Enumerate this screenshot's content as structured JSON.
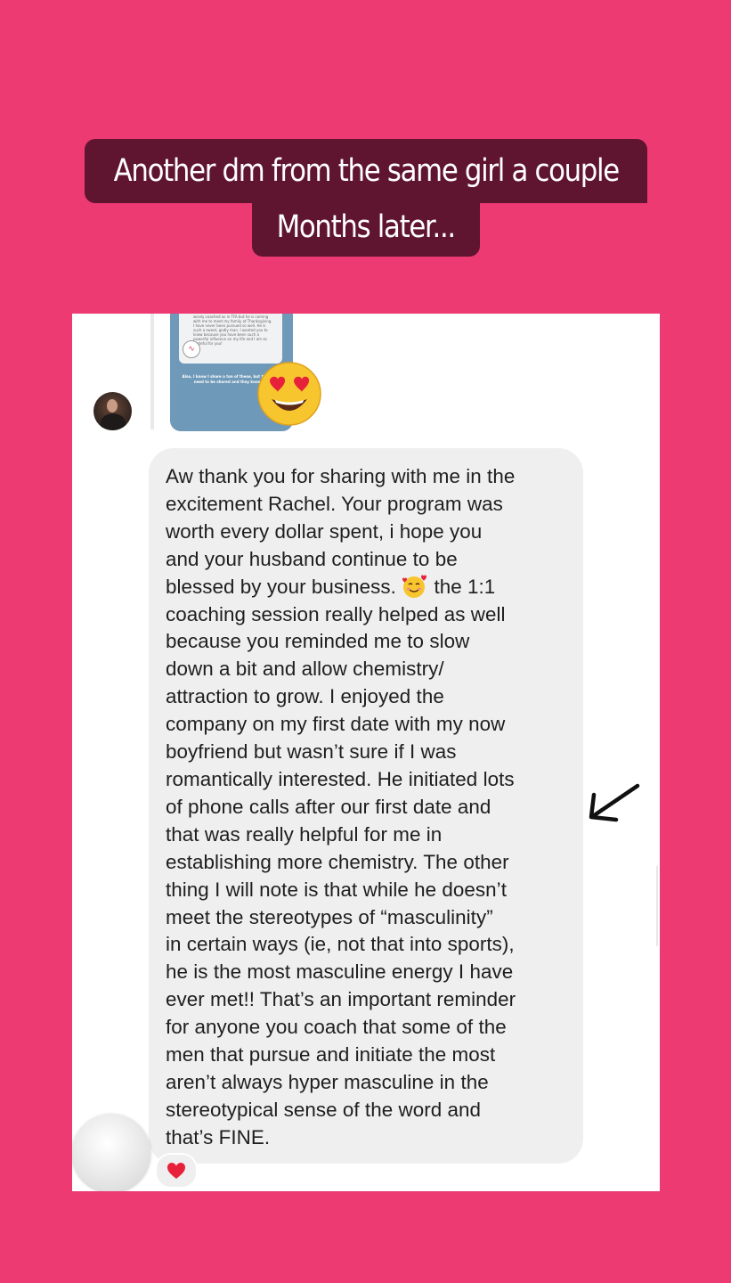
{
  "caption": {
    "line1": "Another dm from the same girl a couple",
    "line2": "Months later..."
  },
  "story_preview": {
    "tiny_text": "wisely coached as in TFA but he is coming with me to meet my family at Thanksgiving. I have never been pursued so well. He is such a sweet, godly man. I wanted you to know because you have been such a powerful influence on my life and I am so grateful for you!",
    "card_caption": "Also, I know I share a ton of these, but they just need to be shared and they know lol"
  },
  "message": {
    "lines": [
      "Aw thank you for sharing with me in the",
      "excitement Rachel. Your program was",
      "worth every dollar spent, i hope you",
      "and your husband continue to be",
      "blessed by your business.",
      "the 1:1",
      "coaching session really helped as well",
      "because you reminded me to slow",
      "down a bit and allow chemistry/",
      "attraction to grow. I enjoyed the",
      "company on my first date with my now",
      "boyfriend but wasn’t sure if I was",
      "romantically interested. He initiated lots",
      "of phone calls after our first date and",
      "that was really helpful for me in",
      "establishing more chemistry. The other",
      "thing I will note is that while he doesn’t",
      "meet the stereotypes of “masculinity”",
      "in certain ways (ie, not that into sports),",
      "he is the most masculine energy I have",
      "ever met!! That’s an important reminder",
      "for anyone you coach that some of the",
      "men that pursue and initiate the most",
      "aren’t always hyper masculine in the",
      "stereotypical sense of the word and",
      "that’s FINE."
    ],
    "reaction": "heart"
  },
  "colors": {
    "background": "#ee3a72",
    "caption_bg": "#5f1430",
    "bubble": "#efefef",
    "story_card": "#6f99b8"
  },
  "icons": [
    "heart-eyes-emoji",
    "smiling-face-with-hearts-emoji",
    "heart-reaction-icon",
    "arrow-annotation-icon"
  ]
}
